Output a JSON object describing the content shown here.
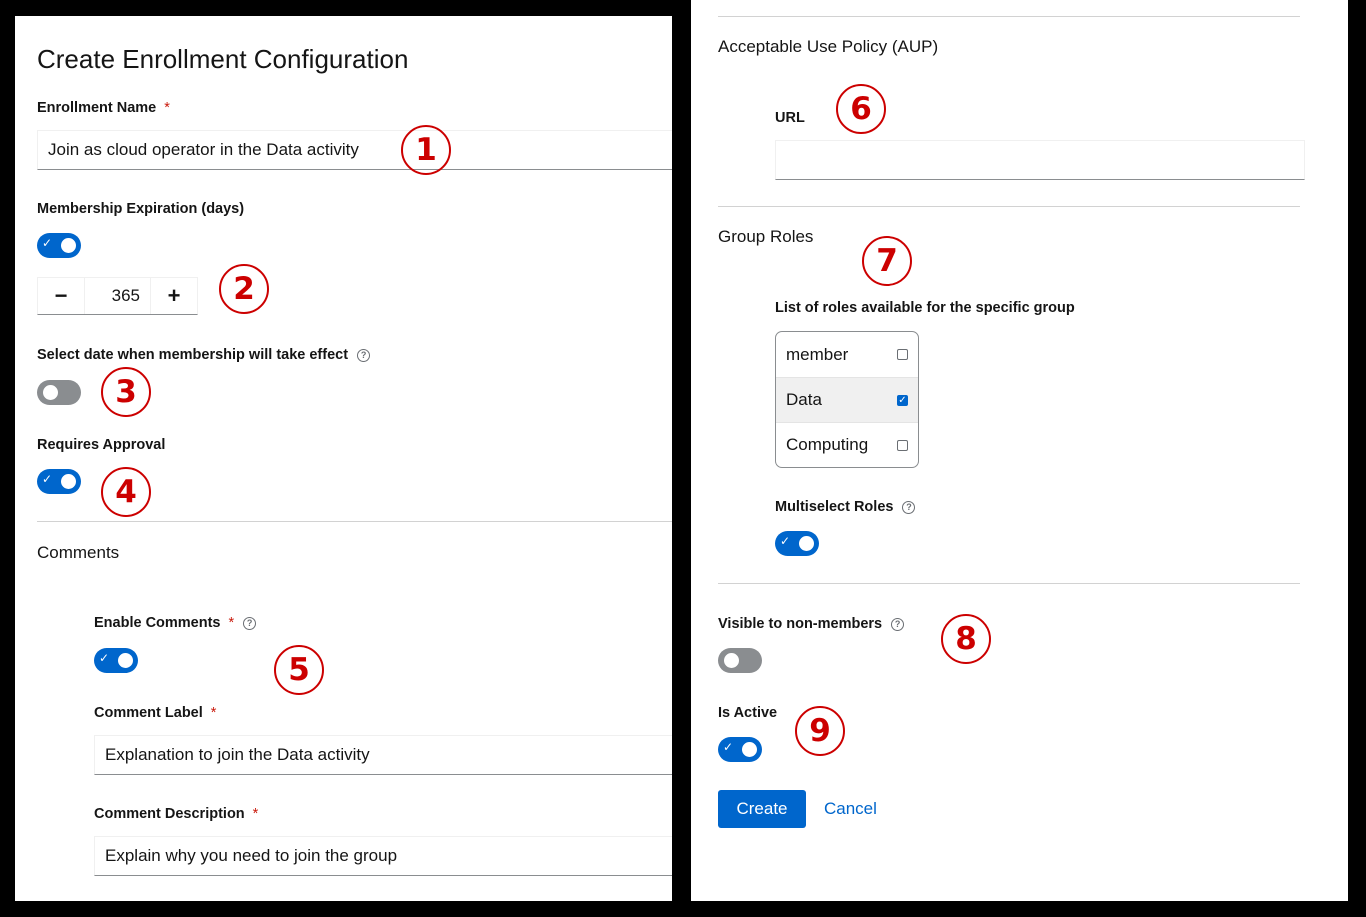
{
  "form": {
    "title": "Create Enrollment Configuration",
    "enrollment_name": {
      "label": "Enrollment Name",
      "required": "*",
      "value": "Join as cloud operator in the Data activity"
    },
    "membership_expiration": {
      "label": "Membership Expiration (days)",
      "enabled": true,
      "minus": "−",
      "value": "365",
      "plus": "+"
    },
    "effective_date": {
      "label": "Select date when membership will take effect",
      "help": "?",
      "enabled": false
    },
    "requires_approval": {
      "label": "Requires Approval",
      "enabled": true
    },
    "comments": {
      "section": "Comments",
      "enable_label": "Enable Comments",
      "required": "*",
      "help": "?",
      "enabled": true,
      "comment_label": {
        "label": "Comment Label",
        "required": "*",
        "value": "Explanation to join the Data activity"
      },
      "comment_description": {
        "label": "Comment Description",
        "required": "*",
        "value": "Explain why you need to join the group"
      }
    },
    "aup": {
      "section": "Acceptable Use Policy (AUP)",
      "url_label": "URL",
      "url_value": ""
    },
    "group_roles": {
      "section": "Group Roles",
      "list_label": "List of roles available for the specific group",
      "roles": [
        {
          "name": "member",
          "checked": false
        },
        {
          "name": "Data",
          "checked": true
        },
        {
          "name": "Computing",
          "checked": false
        }
      ],
      "multiselect_label": "Multiselect Roles",
      "help": "?",
      "multiselect": true
    },
    "visible": {
      "label": "Visible to non-members",
      "help": "?",
      "enabled": false
    },
    "is_active": {
      "label": "Is Active",
      "enabled": true
    },
    "actions": {
      "create": "Create",
      "cancel": "Cancel"
    }
  },
  "annotations": [
    "1",
    "2",
    "3",
    "4",
    "5",
    "6",
    "7",
    "8",
    "9"
  ],
  "colors": {
    "primary": "#0066cc",
    "toggle_off": "#8a8d90",
    "annotation": "#cc0000",
    "required": "#c9190b"
  }
}
